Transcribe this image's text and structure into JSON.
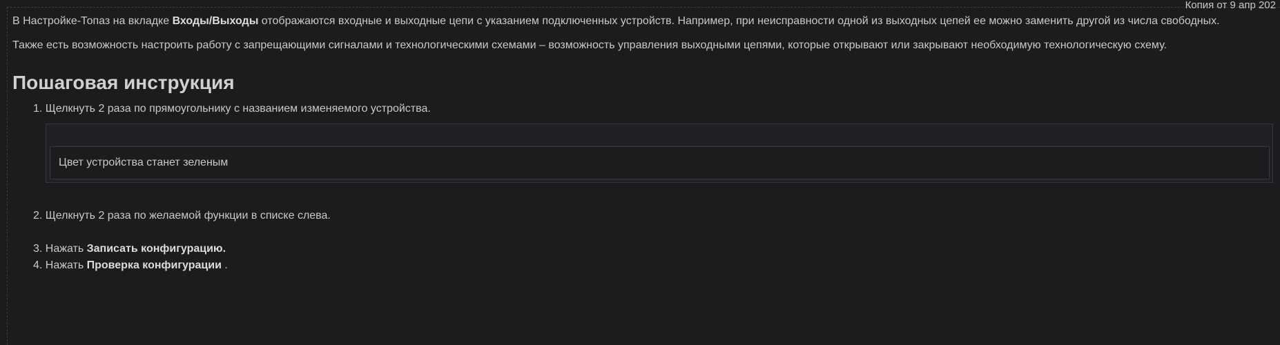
{
  "header": {
    "meta_text": "Копия от 9 апр 202"
  },
  "intro": {
    "p1_before": "В Настройке-Топаз на  вкладке ",
    "p1_bold": "Входы/Выходы",
    "p1_after": " отображаются входные  и  выходные  цепи  с  указанием  подключенных  устройств. Например, при неисправности одной из выходных цепей ее можно заменить  другой  из  числа свободных.",
    "p2": "Также  есть  возможность  настроить работу  с  запрещающими  сигналами  и  технологическими  схемами  –  возможность  управления  выходными  цепями,  которые  открывают  или закрывают необходимую технологическую схему."
  },
  "instruction": {
    "title": "Пошаговая инструкция",
    "step1": "1. Щелкнуть 2 раза по прямоугольнику с названием изменяемого устройства.",
    "note": "Цвет устройства станет зеленым",
    "step2": "2. Щелкнуть 2 раза по желаемой функции в списке слева.",
    "step3_prefix": "3. Нажать ",
    "step3_bold": "Записать конфигурацию.",
    "step4_prefix": "4. Нажать ",
    "step4_bold": "Проверка  конфигурации",
    "step4_suffix": " ."
  }
}
